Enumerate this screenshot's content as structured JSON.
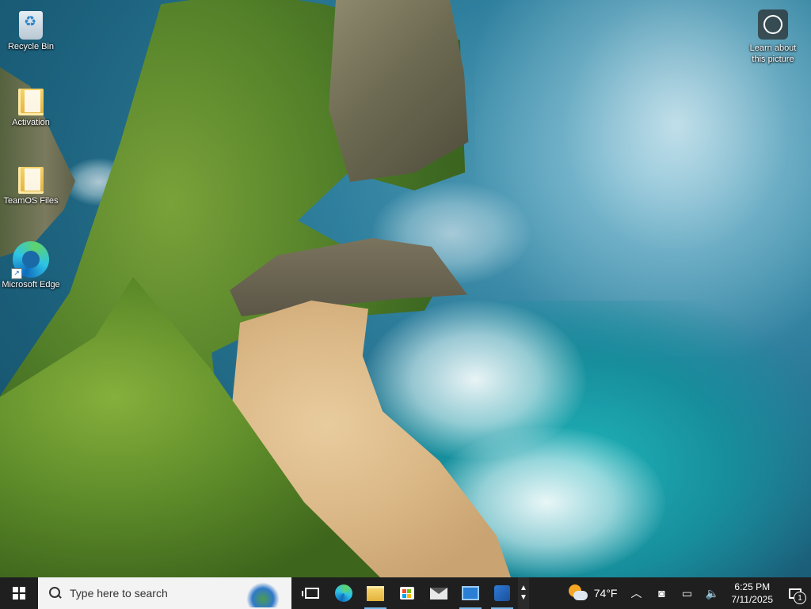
{
  "desktop": {
    "icons": [
      {
        "label": "Recycle Bin",
        "icon": "recycle-bin-icon"
      },
      {
        "label": "Activation",
        "icon": "folder-icon"
      },
      {
        "label": "TeamOS Files",
        "icon": "folder-icon"
      },
      {
        "label": "Microsoft Edge",
        "icon": "edge-icon"
      }
    ],
    "spotlight_label": "Learn about this picture"
  },
  "taskbar": {
    "search_placeholder": "Type here to search",
    "weather_temp": "74°F",
    "clock_time": "6:25 PM",
    "clock_date": "7/11/2025",
    "notification_count": "1",
    "accent": "#76b9ed"
  }
}
